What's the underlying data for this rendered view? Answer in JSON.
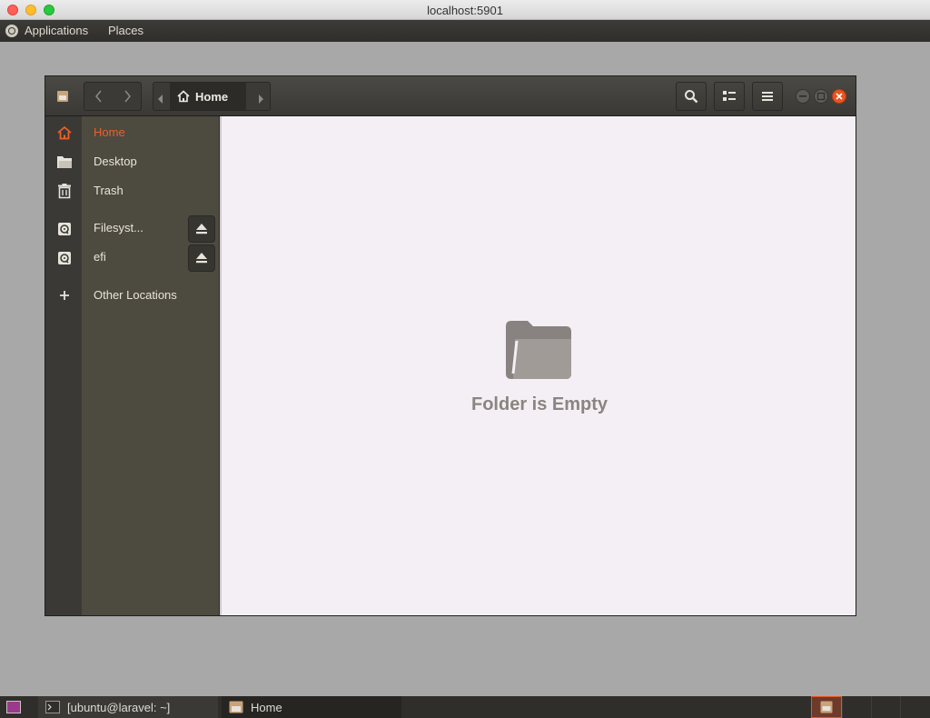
{
  "vnc_window": {
    "title": "localhost:5901"
  },
  "top_panel": {
    "applications": "Applications",
    "places": "Places"
  },
  "headerbar": {
    "path": "Home",
    "icons": [
      "nautilus-app-icon",
      "back-icon",
      "forward-icon",
      "path-left-icon",
      "home-icon",
      "path-right-icon",
      "search-icon",
      "view-list-icon",
      "menu-icon",
      "minimize-icon",
      "maximize-icon",
      "close-icon"
    ]
  },
  "sidebar": {
    "items": [
      {
        "label": "Home",
        "icon": "home-icon",
        "active": true
      },
      {
        "label": "Desktop",
        "icon": "folder-icon"
      },
      {
        "label": "Trash",
        "icon": "trash-icon"
      },
      {
        "label": "Filesyst...",
        "icon": "drive-icon",
        "eject": true
      },
      {
        "label": "efi",
        "icon": "drive-icon",
        "eject": true
      },
      {
        "label": "Other Locations",
        "icon": "plus-icon"
      }
    ]
  },
  "content": {
    "empty_message": "Folder is Empty"
  },
  "taskbar": {
    "tasks": [
      {
        "label": "[ubuntu@laravel: ~]",
        "icon": "terminal-icon"
      },
      {
        "label": "Home",
        "icon": "files-icon"
      }
    ]
  },
  "colors": {
    "accent": "#e9622c",
    "sidebar": "#4d4a40",
    "content_bg": "#f3eff4",
    "close": "#e95420"
  }
}
